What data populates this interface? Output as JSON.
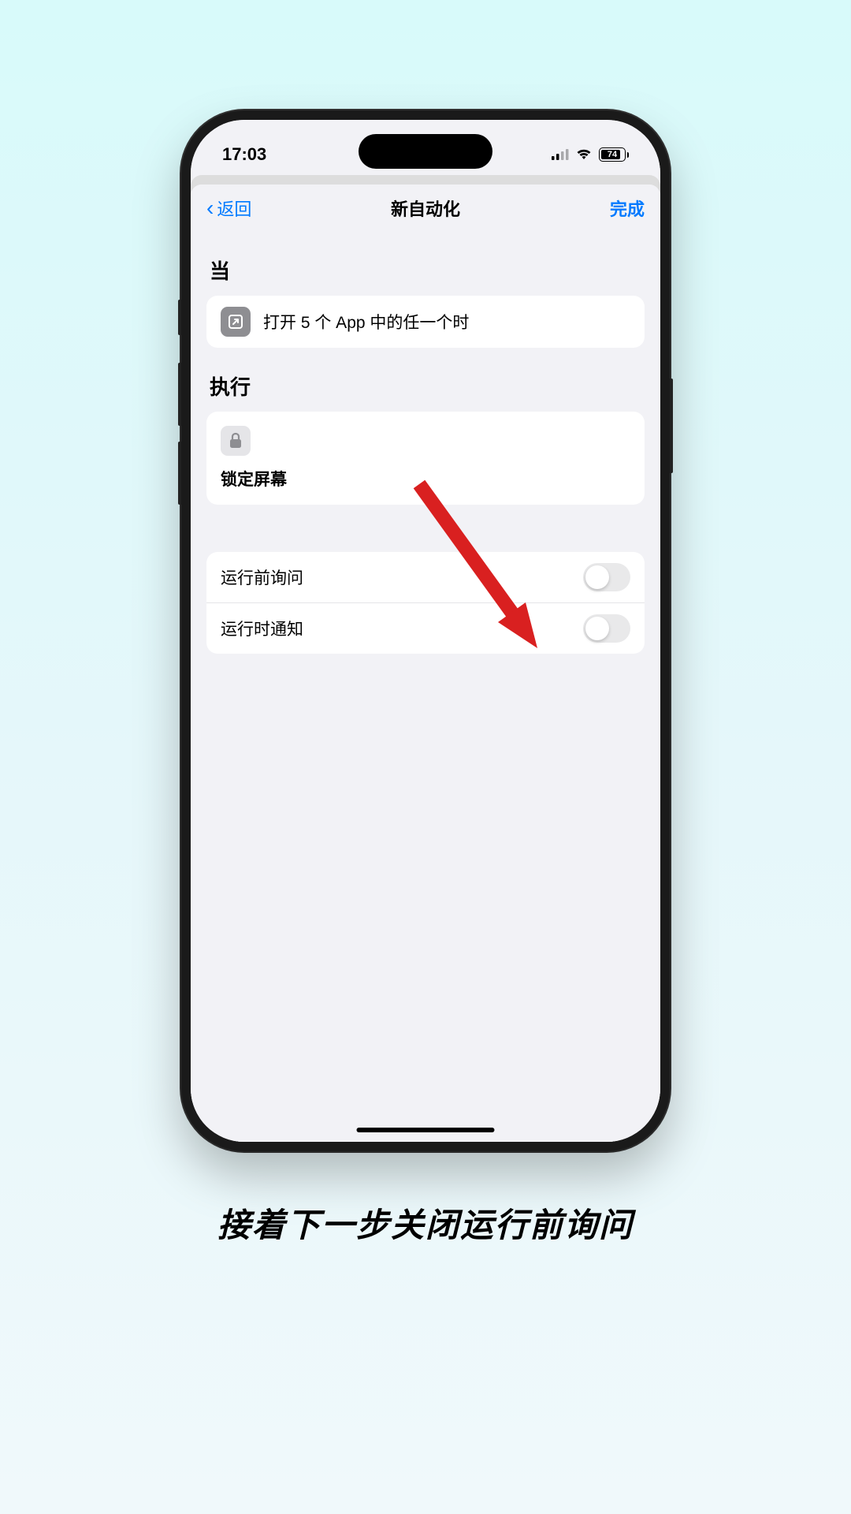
{
  "status_bar": {
    "time": "17:03",
    "battery": "74"
  },
  "nav": {
    "back_label": "返回",
    "title": "新自动化",
    "done_label": "完成"
  },
  "sections": {
    "when_header": "当",
    "when_condition": "打开 5 个 App 中的任一个时",
    "do_header": "执行",
    "do_action": "锁定屏幕"
  },
  "toggles": {
    "ask_before": {
      "label": "运行前询问",
      "state": false
    },
    "notify_when_run": {
      "label": "运行时通知",
      "state": false
    }
  },
  "caption": "接着下一步关闭运行前询问"
}
